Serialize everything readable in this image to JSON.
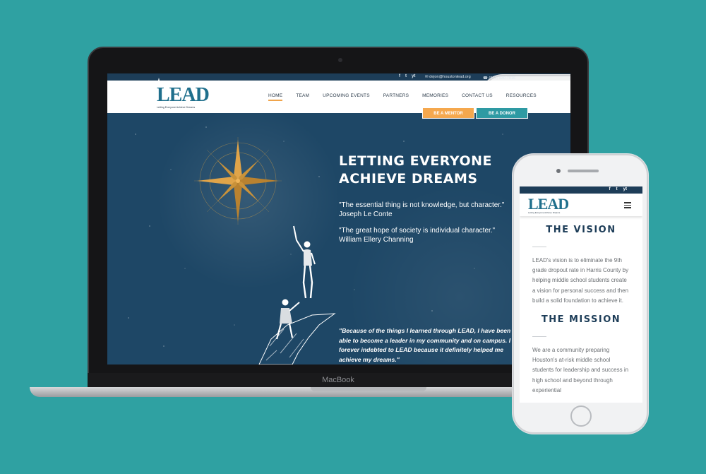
{
  "desktop": {
    "top_bar": {
      "email": "dejon@houstonlead.org",
      "phone": "(832) 930-7016",
      "social": [
        "f",
        "t",
        "yt"
      ]
    },
    "logo": {
      "mark": "LEAD",
      "tagline": "Letting Everyone Achieve Dreams"
    },
    "nav": [
      "HOME",
      "TEAM",
      "UPCOMING EVENTS",
      "PARTNERS",
      "MEMORIES",
      "CONTACT US",
      "RESOURCES"
    ],
    "cta": {
      "mentor": "BE A MENTOR",
      "donor": "BE A DONOR"
    },
    "hero": {
      "title_line1": "LETTING EVERYONE",
      "title_line2": "ACHIEVE DREAMS",
      "quote1_text": "\"The essential thing is not knowledge, but character.\"",
      "quote1_author": "Joseph Le Conte",
      "quote2_text": "\"The great hope of society is individual character.\"",
      "quote2_author": "William Ellery Channing",
      "testimonial": "\"Because of the things I learned through LEAD, I have been able to become a leader in my community and on campus. I am forever indebted to LEAD because it definitely helped me achieve my dreams.\""
    }
  },
  "device": {
    "laptop_label": "MacBook"
  },
  "mobile": {
    "social": [
      "f",
      "t",
      "yt"
    ],
    "logo": {
      "mark": "LEAD",
      "tagline": "Letting Everyone Achieve Dreams"
    },
    "vision": {
      "title": "THE VISION",
      "text": "LEAD's vision is to eliminate the 9th grade dropout rate in Harris County by helping middle school students create a vision for personal success and then build a solid foundation to achieve it."
    },
    "mission": {
      "title": "THE MISSION",
      "text": "We are a community preparing Houston's at-risk middle school students for leadership and success in high school and beyond through experiential"
    }
  },
  "colors": {
    "background": "#2fa1a2",
    "navy": "#1d3d58",
    "hero_blue": "#1e4766",
    "orange": "#f5a84e",
    "teal": "#2e9aa3",
    "logo_teal": "#1f6f8c"
  }
}
